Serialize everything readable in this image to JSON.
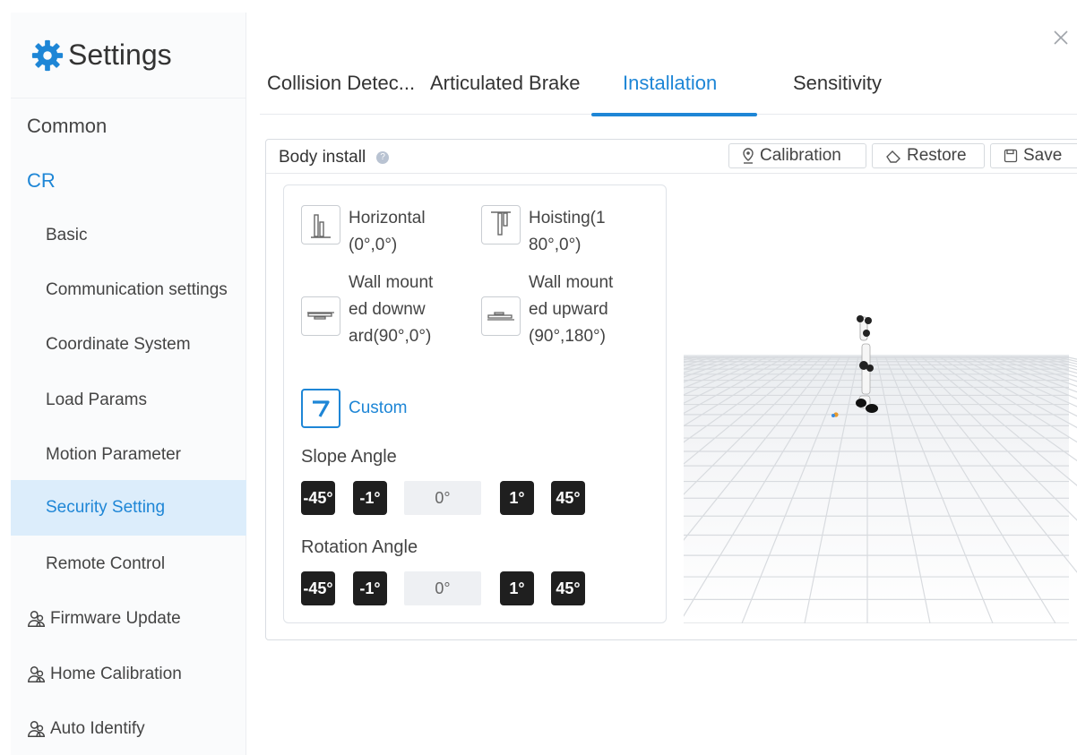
{
  "sidebar": {
    "title": "Settings",
    "items": [
      {
        "label": "Common"
      },
      {
        "label": "CR"
      },
      {
        "label": "Basic"
      },
      {
        "label": "Communication settings"
      },
      {
        "label": "Coordinate System"
      },
      {
        "label": "Load Params"
      },
      {
        "label": "Motion Parameter"
      },
      {
        "label": "Security Setting"
      },
      {
        "label": "Remote Control"
      },
      {
        "label": "Firmware Update",
        "icon": "user-group-icon"
      },
      {
        "label": "Home Calibration",
        "icon": "user-group-icon"
      },
      {
        "label": "Auto Identify",
        "icon": "user-group-icon"
      }
    ]
  },
  "tabs": [
    {
      "label": "Collision Detec..."
    },
    {
      "label": "Articulated Brake"
    },
    {
      "label": "Installation"
    },
    {
      "label": "Sensitivity"
    }
  ],
  "panel": {
    "title": "Body install",
    "buttons": {
      "calibration": "Calibration",
      "restore": "Restore",
      "save": "Save"
    },
    "options": [
      {
        "label": "Horizontal(0°,0°)",
        "icon": "horizontal-mount-icon"
      },
      {
        "label": "Hoisting(180°,0°)",
        "icon": "hoisting-mount-icon"
      },
      {
        "label": "Wall mounted downward(90°,0°)",
        "icon": "wall-down-mount-icon"
      },
      {
        "label": "Wall mounted upward(90°,180°)",
        "icon": "wall-up-mount-icon"
      },
      {
        "label": "Custom",
        "icon": "custom-mount-icon"
      }
    ],
    "slope": {
      "label": "Slope Angle",
      "dec_big": "-45°",
      "dec_small": "-1°",
      "value": "0°",
      "inc_small": "1°",
      "inc_big": "45°"
    },
    "rotation": {
      "label": "Rotation Angle",
      "dec_big": "-45°",
      "dec_small": "-1°",
      "value": "0°",
      "inc_small": "1°",
      "inc_big": "45°"
    }
  },
  "colors": {
    "accent": "#1e86d6",
    "active_bg": "#dcedfb",
    "step_btn": "#1f1f1f"
  }
}
